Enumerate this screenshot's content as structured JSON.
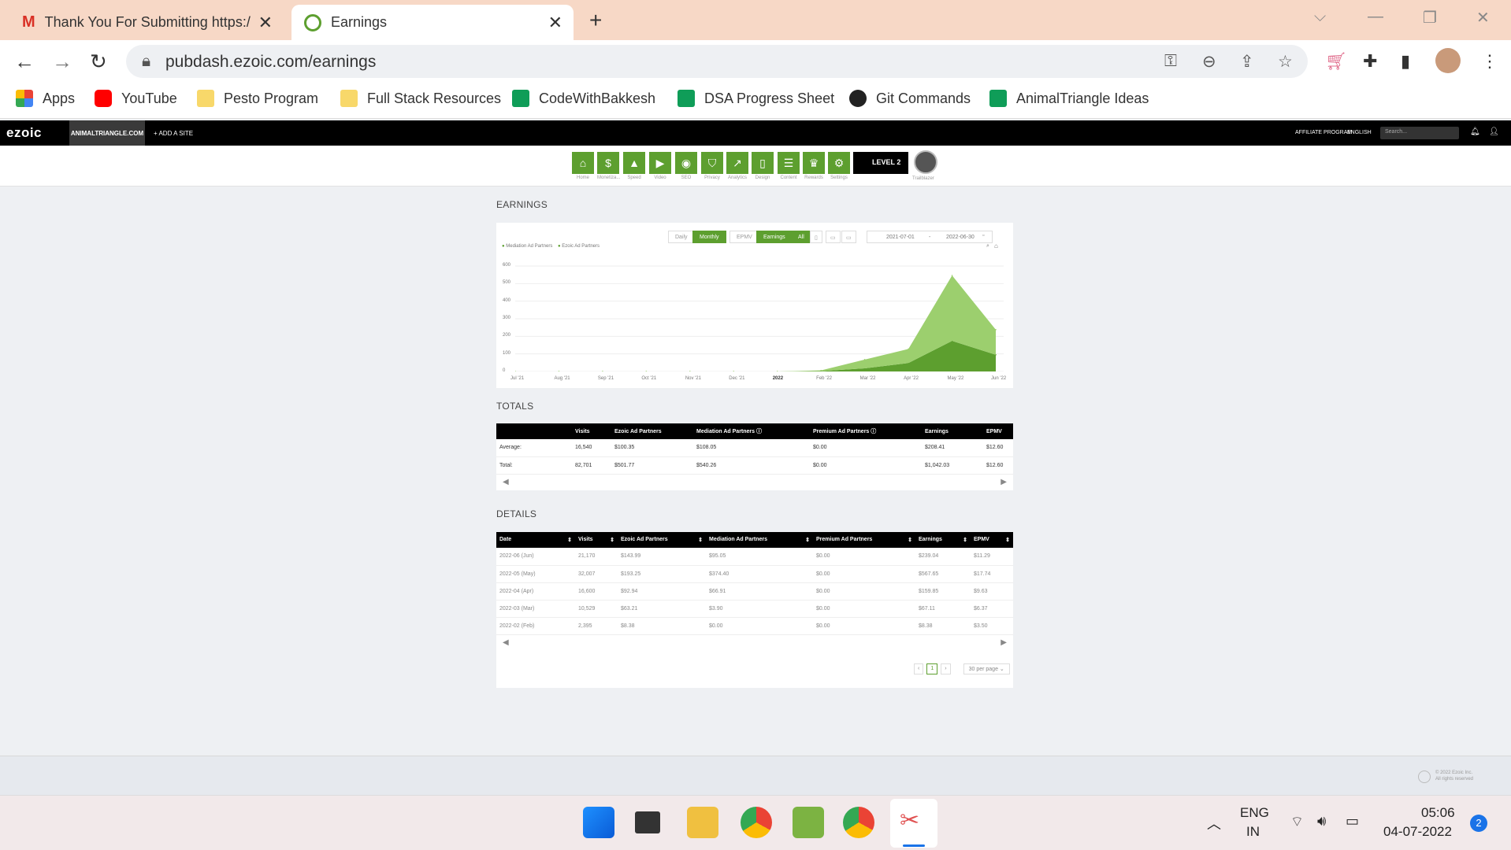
{
  "browser": {
    "tabs": [
      {
        "title": "Thank You For Submitting https:/",
        "favicon": "gmail-icon",
        "active": false
      },
      {
        "title": "Earnings",
        "favicon": "ezoic-icon",
        "active": true
      }
    ],
    "url": "pubdash.ezoic.com/earnings",
    "bookmarks": [
      {
        "label": "Apps",
        "icon": "apps-grid-icon"
      },
      {
        "label": "YouTube",
        "icon": "youtube-icon"
      },
      {
        "label": "Pesto Program",
        "icon": "folder-icon"
      },
      {
        "label": "Full Stack Resources",
        "icon": "folder-icon"
      },
      {
        "label": "CodeWithBakkesh",
        "icon": "sheets-icon"
      },
      {
        "label": "DSA Progress Sheet",
        "icon": "sheets-icon"
      },
      {
        "label": "Git Commands",
        "icon": "globe-icon"
      },
      {
        "label": "AnimalTriangle Ideas",
        "icon": "sheets-icon"
      }
    ]
  },
  "ezoic": {
    "logo": "ezoic",
    "site": "ANIMALTRIANGLE.COM",
    "add_site": "+ ADD A SITE",
    "affiliate": "AFFILIATE PROGRAM",
    "language": "ENGLISH",
    "search_placeholder": "Search...",
    "nav": [
      {
        "label": "Home",
        "icon": "home-icon"
      },
      {
        "label": "Monetiza...",
        "icon": "dollar-icon"
      },
      {
        "label": "Speed",
        "icon": "rocket-icon"
      },
      {
        "label": "Video",
        "icon": "video-icon"
      },
      {
        "label": "SEO",
        "icon": "seo-icon"
      },
      {
        "label": "Privacy",
        "icon": "shield-icon"
      },
      {
        "label": "Analytics",
        "icon": "analytics-icon"
      },
      {
        "label": "Design",
        "icon": "design-icon"
      },
      {
        "label": "Content",
        "icon": "content-icon"
      },
      {
        "label": "Rewards",
        "icon": "trophy-icon"
      },
      {
        "label": "Settings",
        "icon": "gear-icon"
      }
    ],
    "level": "LEVEL 2",
    "trailblazer": "Trailblazer"
  },
  "earnings": {
    "heading": "EARNINGS",
    "buttons": [
      "Daily",
      "Monthly",
      "EPMV",
      "Earnings",
      "All"
    ],
    "date_from": "2021-07-01",
    "date_sep": "-",
    "date_to": "2022-06-30"
  },
  "chart_data": {
    "type": "area",
    "x": [
      "Jul '21",
      "Aug '21",
      "Sep '21",
      "Oct '21",
      "Nov '21",
      "Dec '21",
      "2022",
      "Feb '22",
      "Mar '22",
      "Apr '22",
      "May '22",
      "Jun '22"
    ],
    "series": [
      {
        "name": "Mediation Ad Partners",
        "color": "#5d9f2f",
        "values": [
          0,
          0,
          0,
          0,
          0,
          0,
          0,
          2,
          18,
          48,
          174,
          95
        ]
      },
      {
        "name": "Ezoic Ad Partners",
        "color": "#9ccf6e",
        "values": [
          0,
          0,
          0,
          0,
          0,
          0,
          0,
          4,
          50,
          80,
          372,
          143
        ]
      }
    ],
    "stacked": true,
    "yticks": [
      "600",
      "500",
      "400",
      "300",
      "200",
      "100",
      "0"
    ],
    "ylim": [
      0,
      600
    ],
    "legend": "top-left",
    "grid": true
  },
  "totals": {
    "heading": "TOTALS",
    "columns": [
      "",
      "Visits",
      "Ezoic Ad Partners",
      "Mediation Ad Partners",
      "Premium Ad Partners",
      "Earnings",
      "EPMV"
    ],
    "rows": [
      [
        "Average:",
        "16,540",
        "$100.35",
        "$108.05",
        "$0.00",
        "$208.41",
        "$12.60"
      ],
      [
        "Total:",
        "82,701",
        "$501.77",
        "$540.26",
        "$0.00",
        "$1,042.03",
        "$12.60"
      ]
    ]
  },
  "details": {
    "heading": "DETAILS",
    "columns": [
      "Date",
      "Visits",
      "Ezoic Ad Partners",
      "Mediation Ad Partners",
      "Premium Ad Partners",
      "Earnings",
      "EPMV"
    ],
    "rows": [
      [
        "2022-06 (Jun)",
        "21,170",
        "$143.99",
        "$95.05",
        "$0.00",
        "$239.04",
        "$11.29"
      ],
      [
        "2022-05 (May)",
        "32,007",
        "$193.25",
        "$374.40",
        "$0.00",
        "$567.65",
        "$17.74"
      ],
      [
        "2022-04 (Apr)",
        "16,600",
        "$92.94",
        "$66.91",
        "$0.00",
        "$159.85",
        "$9.63"
      ],
      [
        "2022-03 (Mar)",
        "10,529",
        "$63.21",
        "$3.90",
        "$0.00",
        "$67.11",
        "$6.37"
      ],
      [
        "2022-02 (Feb)",
        "2,395",
        "$8.38",
        "$0.00",
        "$0.00",
        "$8.38",
        "$3.50"
      ]
    ],
    "page": "1",
    "per_page": "30 per page"
  },
  "footer": {
    "copyright": "© 2022 Ezoic Inc.",
    "rights": "All rights reserved"
  },
  "taskbar": {
    "lang1": "ENG",
    "lang2": "IN",
    "time": "05:06",
    "date": "04-07-2022",
    "notifications": "2"
  }
}
